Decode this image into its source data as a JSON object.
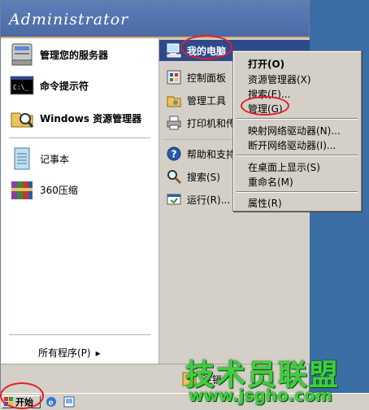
{
  "user": {
    "name": "Administrator"
  },
  "left_column": {
    "pinned": [
      {
        "label": "管理您的服务器",
        "icon": "server-icon"
      },
      {
        "label": "命令提示符",
        "icon": "cmd-icon"
      },
      {
        "label": "Windows 资源管理器",
        "icon": "explorer-icon"
      }
    ],
    "recent": [
      {
        "label": "记事本",
        "icon": "notepad-icon"
      },
      {
        "label": "360压缩",
        "icon": "archive-icon"
      }
    ],
    "all_programs": "所有程序(P)",
    "all_programs_arrow": "▸"
  },
  "right_column": {
    "items": [
      {
        "label": "我的电脑",
        "icon": "my-computer-icon",
        "selected": true
      },
      {
        "label": "控制面板",
        "icon": "control-panel-icon"
      },
      {
        "label": "管理工具",
        "icon": "admin-tools-icon"
      },
      {
        "label": "打印机和传",
        "icon": "printer-icon"
      },
      {
        "label": "帮助和支持",
        "icon": "help-icon"
      },
      {
        "label": "搜索(S)",
        "icon": "search-icon"
      },
      {
        "label": "运行(R)...",
        "icon": "run-icon"
      }
    ]
  },
  "context_menu": {
    "items": [
      {
        "label": "打开(O)",
        "default": true
      },
      {
        "label": "资源管理器(X)"
      },
      {
        "label": "搜索(E)..."
      },
      {
        "label": "管理(G)"
      },
      {
        "label": "映射网络驱动器(N)..."
      },
      {
        "label": "断开网络驱动器(I)..."
      },
      {
        "label": "在桌面上显示(S)"
      },
      {
        "label": "重命名(M)"
      },
      {
        "label": "属性(R)"
      }
    ]
  },
  "footer": {
    "logoff_label": "注销"
  },
  "taskbar": {
    "start_label": "开始"
  },
  "watermark": {
    "title": "技术员联盟",
    "url": "www.jsgho.com"
  },
  "colors": {
    "header": "#4a6aa5",
    "selection": "#2c4a8c",
    "annotation": "#e0202a",
    "watermark": "#3fcf3f",
    "desktop": "#3a6ea5"
  }
}
